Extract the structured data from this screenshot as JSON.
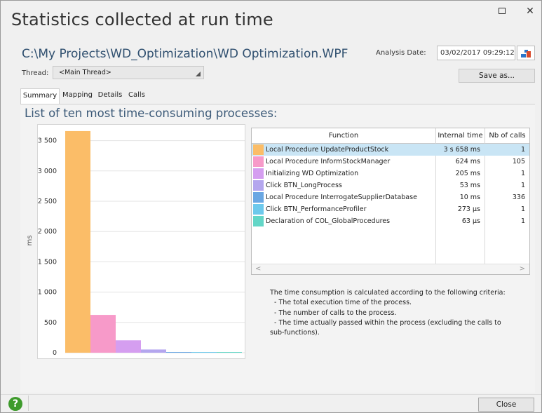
{
  "window": {
    "title": "Statistics collected at run time",
    "maximize_icon": "maximize-icon",
    "close_icon": "close-icon",
    "close_glyph": "✕"
  },
  "header": {
    "project_path": "C:\\My Projects\\WD_Optimization\\WD Optimization.WPF",
    "analysis_date_label": "Analysis Date:",
    "analysis_date_value": "03/02/2017 09:29:12",
    "thread_label": "Thread:",
    "thread_value": "<Main Thread>",
    "save_as_label": "Save as..."
  },
  "tabs": [
    {
      "label": "Summary",
      "active": true
    },
    {
      "label": "Mapping",
      "active": false
    },
    {
      "label": "Details",
      "active": false
    },
    {
      "label": "Calls",
      "active": false
    }
  ],
  "summary": {
    "heading": "List of ten most time-consuming processes:",
    "table": {
      "columns": [
        "Function",
        "Internal time",
        "Nb of calls"
      ],
      "rows": [
        {
          "color": "#fbbd68",
          "function": "Local Procedure UpdateProductStock",
          "time": "3 s 658 ms",
          "calls": "1",
          "selected": true
        },
        {
          "color": "#f79ac9",
          "function": "Local Procedure InformStockManager",
          "time": "624 ms",
          "calls": "105",
          "selected": false
        },
        {
          "color": "#d59ef0",
          "function": "Initializing WD Optimization",
          "time": "205 ms",
          "calls": "1",
          "selected": false
        },
        {
          "color": "#b4a6ee",
          "function": "Click BTN_LongProcess",
          "time": "53 ms",
          "calls": "1",
          "selected": false
        },
        {
          "color": "#6aa7e3",
          "function": "Local Procedure InterrogateSupplierDatabase",
          "time": "10 ms",
          "calls": "336",
          "selected": false
        },
        {
          "color": "#6dc9ec",
          "function": "Click BTN_PerformanceProfiler",
          "time": "273 µs",
          "calls": "1",
          "selected": false
        },
        {
          "color": "#63d6c7",
          "function": "Declaration of COL_GlobalProcedures",
          "time": "63 µs",
          "calls": "1",
          "selected": false
        }
      ]
    },
    "criteria_text": "The time consumption is calculated according to the following criteria:\n  - The total execution time of the process.\n  - The number of calls to the process.\n  - The time actually passed within the process (excluding the calls to\nsub-functions)."
  },
  "chart_data": {
    "type": "bar",
    "ylabel": "ms",
    "ylim": [
      0,
      3750
    ],
    "yticks": [
      0,
      500,
      1000,
      1500,
      2000,
      2500,
      3000,
      3500
    ],
    "ytick_labels": [
      "0",
      "500",
      "1 000",
      "1 500",
      "2 000",
      "2 500",
      "3 000",
      "3 500"
    ],
    "categories": [
      "Local Procedure UpdateProductStock",
      "Local Procedure InformStockManager",
      "Initializing WD Optimization",
      "Click BTN_LongProcess",
      "Local Procedure InterrogateSupplierDatabase",
      "Click BTN_PerformanceProfiler",
      "Declaration of COL_GlobalProcedures"
    ],
    "values": [
      3658,
      624,
      205,
      53,
      10,
      0.273,
      0.063
    ],
    "colors": [
      "#fbbd68",
      "#f79ac9",
      "#d59ef0",
      "#b4a6ee",
      "#6aa7e3",
      "#6dc9ec",
      "#63d6c7"
    ],
    "grid": true
  },
  "footer": {
    "help_icon": "help-icon",
    "help_glyph": "?",
    "close_label": "Close"
  }
}
